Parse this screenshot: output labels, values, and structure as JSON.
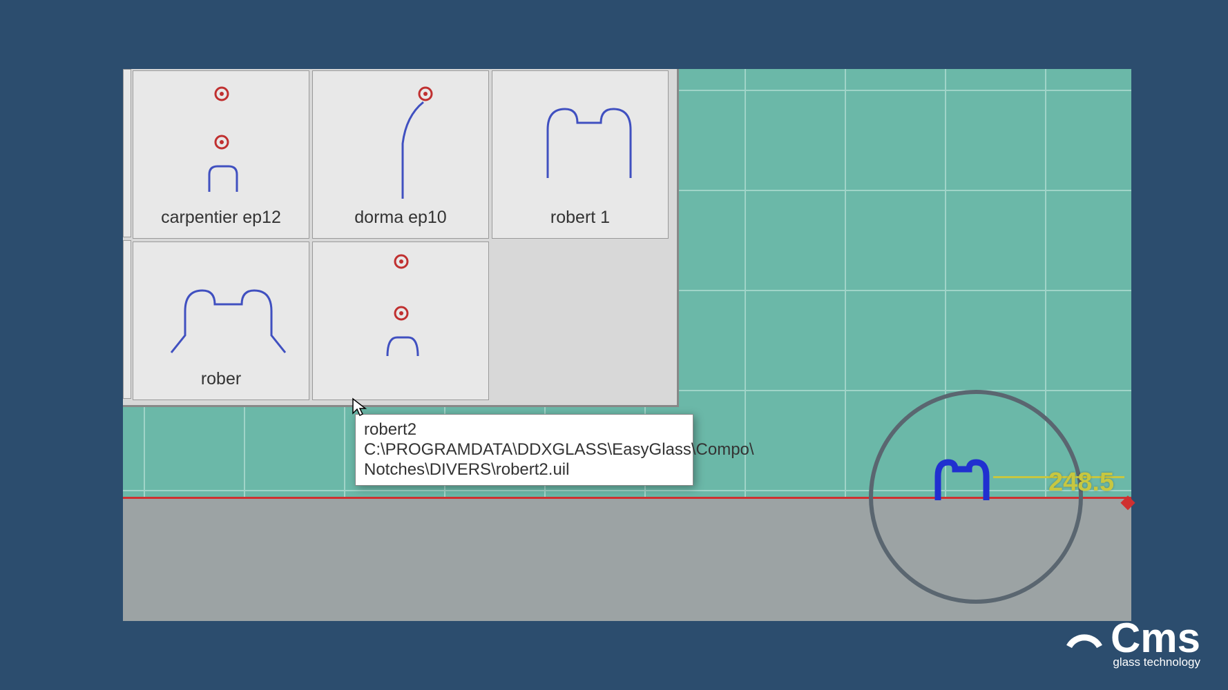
{
  "palette": {
    "items": [
      {
        "label": "carpentier ep12"
      },
      {
        "label": "dorma ep10"
      },
      {
        "label": "robert 1"
      },
      {
        "label": "rober"
      },
      {
        "label": ""
      }
    ]
  },
  "tooltip": {
    "title": "robert2",
    "path1": "C:\\PROGRAMDATA\\DDXGLASS\\EasyGlass\\Compo\\",
    "path2": "Notches\\DIVERS\\robert2.uil"
  },
  "canvas": {
    "dimension": "248.5"
  },
  "logo": {
    "text": "Cms",
    "sub": "glass technology"
  }
}
